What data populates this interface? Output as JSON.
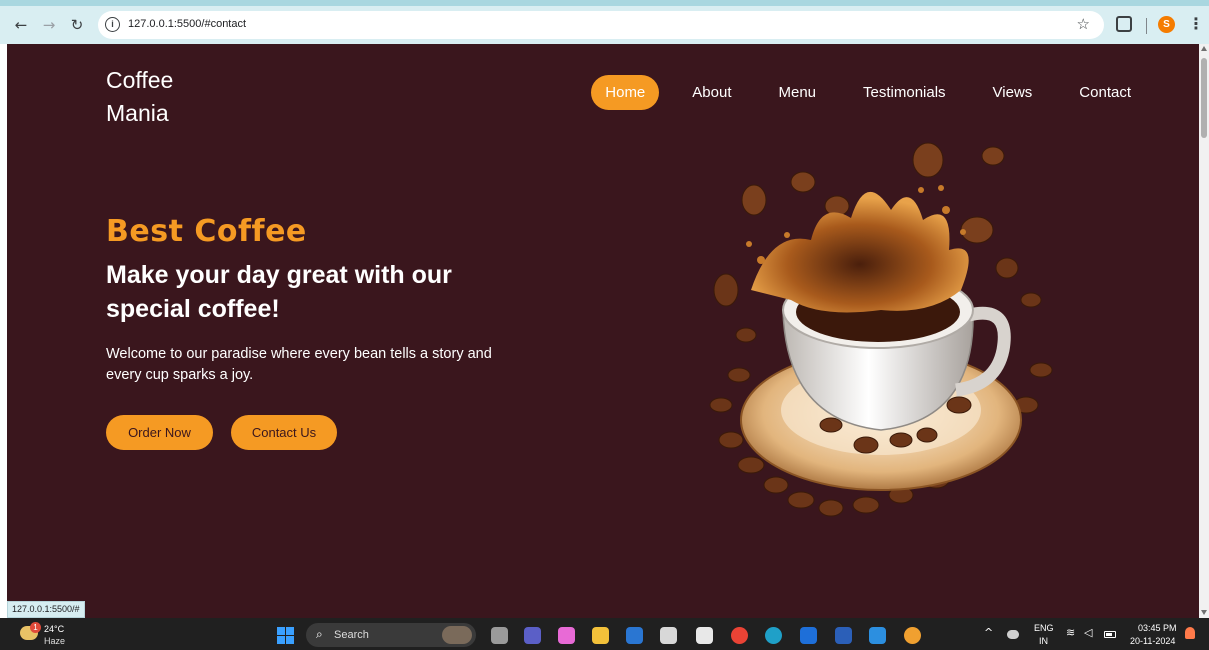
{
  "browser": {
    "url": "127.0.0.1:5500/#contact",
    "status_url": "127.0.0.1:5500/#",
    "profile_initial": "S"
  },
  "site": {
    "logo_line1": "Coffee",
    "logo_line2": "Mania",
    "nav": [
      {
        "label": "Home",
        "active": true
      },
      {
        "label": "About",
        "active": false
      },
      {
        "label": "Menu",
        "active": false
      },
      {
        "label": "Testimonials",
        "active": false
      },
      {
        "label": "Views",
        "active": false
      },
      {
        "label": "Contact",
        "active": false
      }
    ],
    "hero": {
      "kicker": "Best Coffee",
      "title": "Make your day great with our special coffee!",
      "text": "Welcome to our paradise where every bean tells a story and every cup sparks a joy.",
      "order_label": "Order Now",
      "contact_label": "Contact Us"
    }
  },
  "colors": {
    "background": "#3a161d",
    "accent": "#f59a23",
    "text": "#ffffff"
  },
  "taskbar": {
    "weather_temp": "24°C",
    "weather_desc": "Haze",
    "weather_badge": "1",
    "search_label": "Search",
    "lang_line1": "ENG",
    "lang_line2": "IN",
    "time": "03:45 PM",
    "date": "20-11-2024"
  }
}
